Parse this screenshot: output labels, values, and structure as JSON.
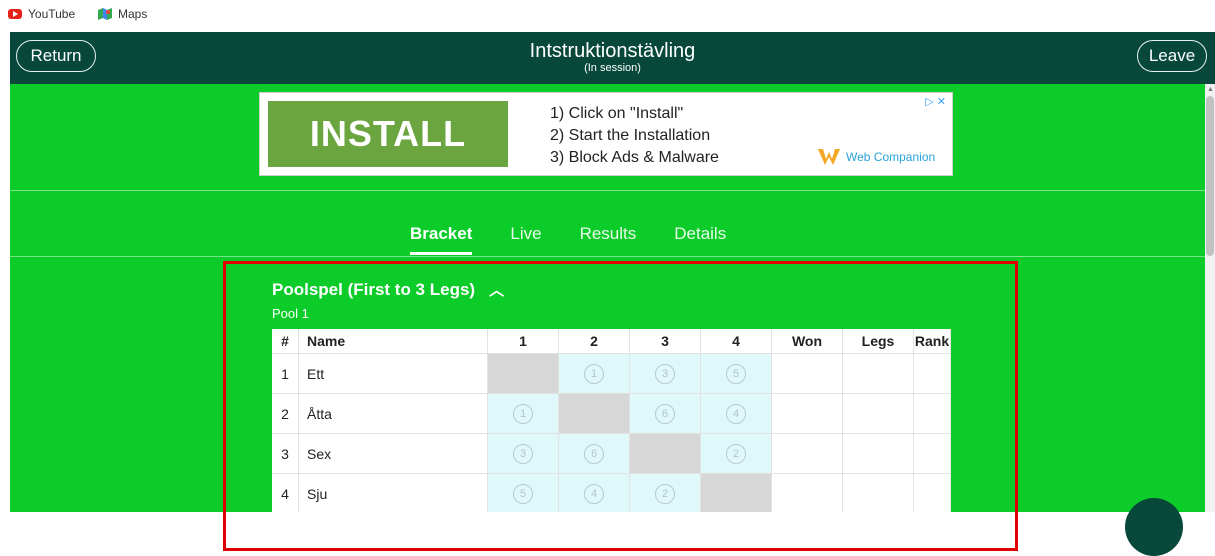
{
  "bookmarks": [
    {
      "label": "YouTube",
      "icon": "youtube-icon"
    },
    {
      "label": "Maps",
      "icon": "maps-icon"
    }
  ],
  "header": {
    "return_label": "Return",
    "title": "Intstruktionstävling",
    "subtitle": "(In session)",
    "leave_label": "Leave"
  },
  "ad": {
    "button_text": "INSTALL",
    "line1": "1) Click on \"Install\"",
    "line2": "2) Start the Installation",
    "line3": "3) Block Ads & Malware",
    "brand": "Web Companion",
    "info": "▷ ✕"
  },
  "tabs": [
    "Bracket",
    "Live",
    "Results",
    "Details"
  ],
  "section": {
    "title": "Poolspel (First to 3 Legs)",
    "pool_label": "Pool 1"
  },
  "table": {
    "headers": [
      "#",
      "Name",
      "1",
      "2",
      "3",
      "4",
      "Won",
      "Legs",
      "Rank"
    ],
    "rows": [
      {
        "num": "1",
        "name": "Ett",
        "cells": [
          "",
          "1",
          "3",
          "5"
        ],
        "won": "",
        "legs": "",
        "rank": ""
      },
      {
        "num": "2",
        "name": "Åtta",
        "cells": [
          "1",
          "",
          "6",
          "4"
        ],
        "won": "",
        "legs": "",
        "rank": ""
      },
      {
        "num": "3",
        "name": "Sex",
        "cells": [
          "3",
          "6",
          "",
          "2"
        ],
        "won": "",
        "legs": "",
        "rank": ""
      },
      {
        "num": "4",
        "name": "Sju",
        "cells": [
          "5",
          "4",
          "2",
          ""
        ],
        "won": "",
        "legs": "",
        "rank": ""
      }
    ]
  },
  "colors": {
    "header_bg": "#07483a",
    "content_bg": "#0ccc2a",
    "highlight": "#e00000",
    "self_cell": "#d7d7d7",
    "match_cell": "#dff9fb"
  }
}
